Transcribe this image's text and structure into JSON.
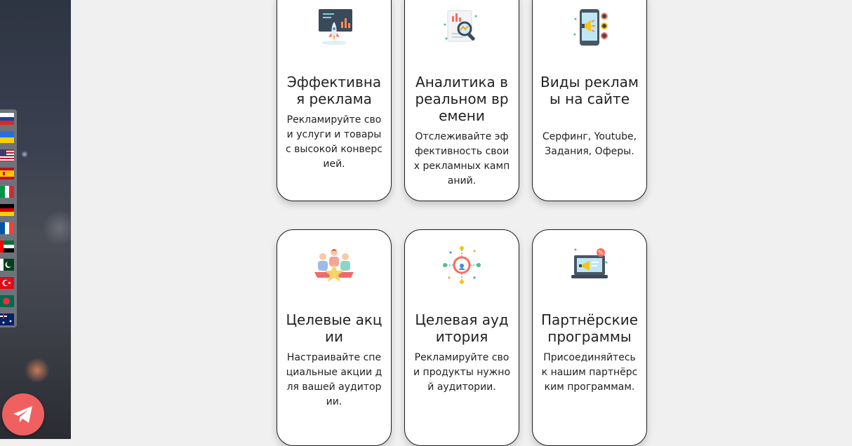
{
  "language_switcher": {
    "flags": [
      {
        "name": "russian",
        "colors": [
          "#ffffff",
          "#1c3fa8",
          "#d52b1e"
        ]
      },
      {
        "name": "ukrainian",
        "colors": [
          "#2b6fd6",
          "#f5d000"
        ]
      },
      {
        "name": "usa",
        "colors": [
          "#b22234",
          "#ffffff",
          "#3c3b6e"
        ]
      },
      {
        "name": "spanish",
        "colors": [
          "#c60b1e",
          "#ffc400"
        ]
      },
      {
        "name": "italian",
        "colors": [
          "#009246",
          "#ffffff",
          "#ce2b37"
        ]
      },
      {
        "name": "german",
        "colors": [
          "#000000",
          "#dd0000",
          "#ffce00"
        ]
      },
      {
        "name": "french",
        "colors": [
          "#0055a4",
          "#ffffff",
          "#ef4135"
        ]
      },
      {
        "name": "uae",
        "colors": [
          "#00732f",
          "#ffffff",
          "#000000",
          "#ff0000"
        ]
      },
      {
        "name": "pakistan",
        "colors": [
          "#01411c",
          "#ffffff"
        ]
      },
      {
        "name": "turkish",
        "colors": [
          "#e30a17",
          "#ffffff"
        ]
      },
      {
        "name": "bangladesh",
        "colors": [
          "#006a4e",
          "#f42a41"
        ]
      },
      {
        "name": "australian",
        "colors": [
          "#012169",
          "#ffffff",
          "#e4002b"
        ]
      }
    ]
  },
  "telegram": {
    "icon": "paper-plane-icon",
    "color": "#f06060"
  },
  "features": [
    {
      "icon": "rocket-presentation-icon",
      "title": "Эффективная реклама",
      "description": "Рекламируйте свои услуги и товары с высокой конверсией."
    },
    {
      "icon": "magnifier-report-icon",
      "title": "Аналитика в реальном времени",
      "description": "Отслеживайте эффективность своих рекламных кампаний."
    },
    {
      "icon": "phone-megaphone-icon",
      "title": "Виды рекламы на сайте",
      "description": "Серфинг, Youtube, Задания, Оферы."
    },
    {
      "icon": "people-star-icon",
      "title": "Целевые акции",
      "description": "Настраивайте специальные акции для вашей аудитории."
    },
    {
      "icon": "target-audience-icon",
      "title": "Целевая аудитория",
      "description": "Рекламируйте свои продукты нужной аудитории."
    },
    {
      "icon": "laptop-megaphone-icon",
      "title": "Партнёрские программы",
      "description": "Присоединяйтесь к нашим партнёрским программам."
    }
  ]
}
